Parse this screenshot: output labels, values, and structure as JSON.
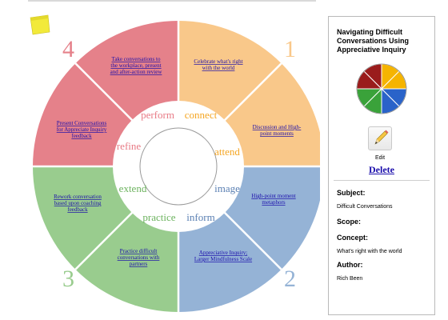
{
  "wheel": {
    "quadrants": [
      {
        "number": "1",
        "color": "#f9c88a"
      },
      {
        "number": "2",
        "color": "#95b3d6"
      },
      {
        "number": "3",
        "color": "#99cc8e"
      },
      {
        "number": "4",
        "color": "#e5818a"
      }
    ],
    "verbs": {
      "perform": "perform",
      "connect": "connect",
      "attend": "attend",
      "image": "image",
      "inform": "inform",
      "practice": "practice",
      "extend": "extend",
      "refine": "refine"
    },
    "verb_colors": {
      "orange": "#f5a623",
      "blue": "#5b80b3",
      "green": "#6db35f",
      "pink": "#e87a85"
    },
    "links": {
      "l1": [
        "Celebrate what's right",
        "with the world"
      ],
      "l2": [
        "Discussion and High-",
        "point moments"
      ],
      "l3": [
        "High-point moment",
        "metaphors"
      ],
      "l4": [
        "Appreciative Inquiry;",
        "Larger Mindfulness Scale"
      ],
      "l5": [
        "Practice difficult",
        "conversations with",
        "partners"
      ],
      "l6": [
        "Rework conversation",
        "based upon coaching",
        "feedback"
      ],
      "l7": [
        "Present Conversations",
        "for Appreciate Inquiry",
        "feedback"
      ],
      "l8": [
        "Take conversations to",
        "the workplace, present",
        "and after-action review"
      ]
    }
  },
  "sidebar": {
    "title": "Navigating Difficult Conversations Using Appreciative Inquiry",
    "mini_colors": [
      "#f5b400",
      "#2a63c9",
      "#3aa23a",
      "#9a1c1c"
    ],
    "edit_label": "Edit",
    "delete_label": "Delete",
    "subject_label": "Subject:",
    "subject_value": "Difficult Conversations",
    "scope_label": "Scope:",
    "concept_label": "Concept:",
    "concept_value": "What's right with the world",
    "author_label": "Author:",
    "author_value": "Rich Been"
  }
}
